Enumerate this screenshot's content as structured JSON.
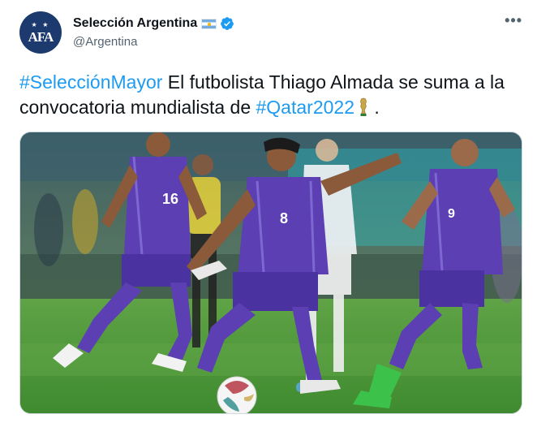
{
  "account": {
    "display_name": "Selección Argentina",
    "handle": "@Argentina",
    "avatar_text": "AFA",
    "avatar_stars": "★ ★",
    "verified": true,
    "flag": "argentina-flag"
  },
  "menu": {
    "more_label": "•••"
  },
  "tweet": {
    "hashtag1": "#SelecciónMayor",
    "body1": " El futbolista Thiago Almada se suma a la convocatoria mundialista de ",
    "hashtag2": "#Qatar2022",
    "end": " ."
  },
  "media": {
    "description_icon": "photo-football-players",
    "jersey_numbers": [
      "16",
      "8",
      "9"
    ]
  },
  "colors": {
    "link": "#1d9bf0",
    "text": "#0f1419",
    "muted": "#536471",
    "verified": "#1d9bf0",
    "jersey": "#5b3fb3",
    "pitch": "#4f9a3b"
  }
}
